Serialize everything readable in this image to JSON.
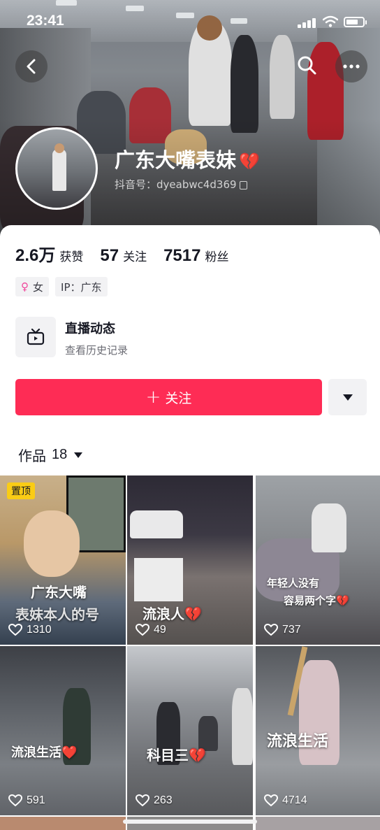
{
  "status_bar": {
    "time": "23:41"
  },
  "profile": {
    "name": "广东大嘴表妹",
    "name_emoji": "💔",
    "handle": "抖音号：dyeabwc4d369",
    "stats": [
      {
        "value": "2.6万",
        "label": "获赞"
      },
      {
        "value": "57",
        "label": "关注"
      },
      {
        "value": "7517",
        "label": "粉丝"
      }
    ],
    "tags": {
      "gender": "女",
      "ip": "IP：广东"
    },
    "live": {
      "title": "直播动态",
      "subtitle": "查看历史记录"
    },
    "follow_label": "关注",
    "works_label": "作品",
    "works_count": "18"
  },
  "videos": [
    {
      "pinned": "置顶",
      "caption": "广东大嘴",
      "caption2": "表妹本人的号",
      "likes": "1310"
    },
    {
      "caption": "流浪人💔",
      "likes": "49"
    },
    {
      "caption": "年轻人没有",
      "caption2": "容易两个字💔",
      "likes": "737"
    },
    {
      "caption": "流浪生活❤️",
      "likes": "591"
    },
    {
      "caption": "科目三💔",
      "likes": "263"
    },
    {
      "caption": "流浪生活",
      "likes": "4714"
    }
  ],
  "colors": {
    "accent": "#fe2c55",
    "pin": "#facc15"
  }
}
